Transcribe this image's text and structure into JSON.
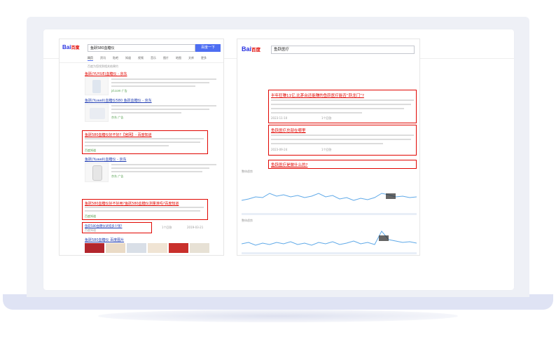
{
  "colors": {
    "accent": "#e10601",
    "brand_blue": "#2932e1",
    "link": "#2440b3",
    "chart_line": "#5fa9e8"
  },
  "left": {
    "logo_text": "Bai",
    "logo_suffix": "百度",
    "search_value": "鱼跃580血糖仪",
    "search_button": "百度一下",
    "tabs": [
      "网页",
      "资讯",
      "贴吧",
      "知道",
      "视频",
      "音乐",
      "图片",
      "地图",
      "文库",
      "更多"
    ],
    "tools": "百度为您找到相关结果约",
    "results": [
      {
        "title": "鱼跃(YUYUE)血糖仪 - 京东",
        "url": "jd.com 广告"
      },
      {
        "title": "鱼跃(Yuwell)血糖仪580 鱼跃血糖仪 - 京东",
        "url": "京东 广告"
      },
      {
        "title": "鱼跃580血糖仪好不好?【官网】- 百度知道",
        "url": "百度知道"
      },
      {
        "title": "鱼跃(Yuwell)血糖仪 - 京东",
        "url": "京东 广告"
      },
      {
        "title": "鱼跃580血糖仪好不好用?鱼跃580血糖仪测量准吗?百度知道",
        "url": "百度知道"
      },
      {
        "title": "鱼跃580血糖仪试纸多少钱?",
        "url": "百度知道",
        "meta": "1个回答",
        "date": "2019-03-21"
      },
      {
        "title": "鱼跃580血糖仪 百度图片",
        "url": "image.baidu.com"
      }
    ]
  },
  "right": {
    "logo_text": "Bai",
    "logo_suffix": "百度",
    "search_value": "鱼跃医疗",
    "results": [
      {
        "title": "半年狂赚11亿,比茅台还能赚的鱼跃医疗能否“跃龙门”?",
        "meta": "2023-11-10",
        "source": "1个回答"
      },
      {
        "title": "鱼跃医疗总部在哪里",
        "meta": "2023-09-24",
        "source": "1个回答"
      },
      {
        "title": "鱼跃医疗是做什么的?"
      }
    ],
    "chart_labels": [
      "整体趋势",
      "整体趋势"
    ]
  }
}
